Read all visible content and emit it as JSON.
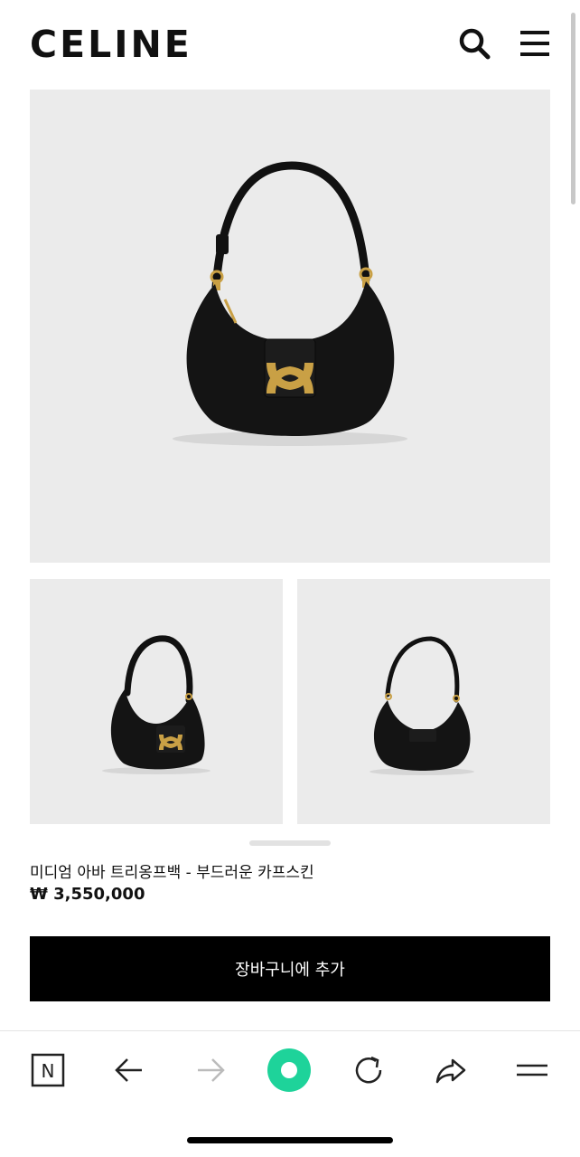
{
  "header": {
    "brand": "CELINE",
    "search_icon": "search-icon",
    "menu_icon": "hamburger-menu-icon"
  },
  "gallery": {
    "main_image": "shoulder-bag-front-view",
    "thumbnails": [
      "shoulder-bag-angled-view",
      "shoulder-bag-back-view"
    ]
  },
  "product": {
    "name": "미디엄 아바 트리옹프백 - 부드러운 카프스킨",
    "price": "₩ 3,550,000"
  },
  "actions": {
    "add_to_cart_label": "장바구니에 추가"
  },
  "browser_nav": {
    "items": [
      "naver-n-icon",
      "back-arrow-icon",
      "forward-arrow-icon",
      "green-record-icon",
      "reload-icon",
      "share-icon",
      "menu-icon"
    ]
  },
  "colors": {
    "accent_green": "#1ed39a",
    "button_bg": "#000000",
    "image_bg": "#ebebeb",
    "gold": "#c9a045"
  }
}
